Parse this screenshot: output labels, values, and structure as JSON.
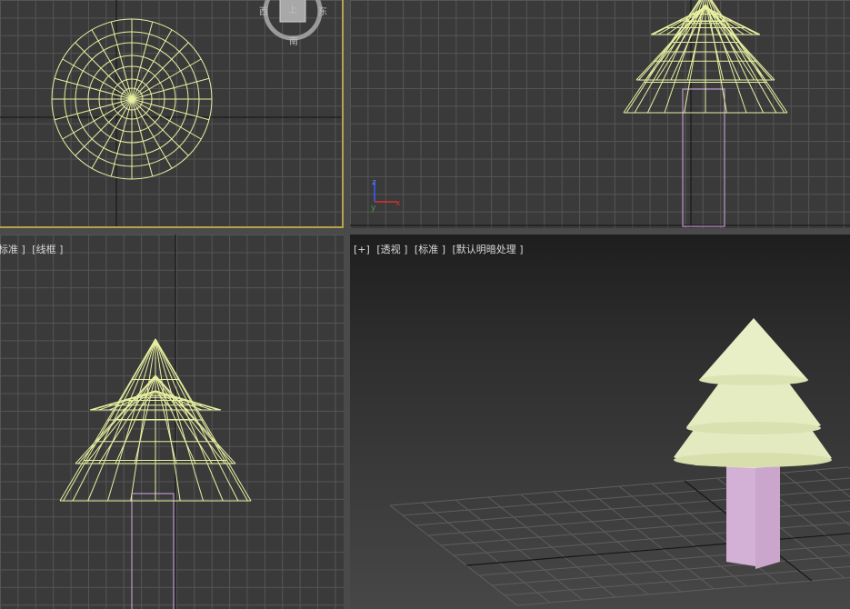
{
  "viewports": {
    "top": {
      "name": "top"
    },
    "front": {
      "name": "front"
    },
    "left": {
      "label": [
        "标准 ]",
        "[线框 ]"
      ]
    },
    "perspective": {
      "label": [
        "[+]",
        "[透视 ]",
        "[标准 ]",
        "[默认明暗处理 ]"
      ]
    }
  },
  "viewcube": {
    "face": "上",
    "west": "西",
    "east": "东",
    "south": "南"
  },
  "axis_gizmo": {
    "x": "x",
    "y": "y",
    "z": "z"
  },
  "colors": {
    "wireframe_foliage": "#e8f0a0",
    "wireframe_trunk": "#d8a8e8",
    "shaded_foliage": "#e6ecc0",
    "shaded_trunk": "#d9b3db",
    "active_border": "#b8a24a"
  }
}
